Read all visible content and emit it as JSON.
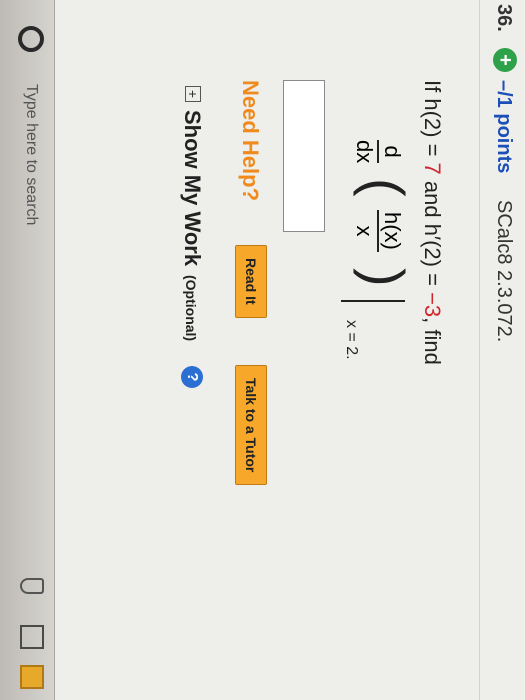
{
  "question": {
    "number": "36.",
    "points": "–/1 points",
    "code": "SCalc8 2.3.072.",
    "plus_icon": "plus-circle-icon"
  },
  "problem": {
    "p1": "If ",
    "p2": "h(2) = ",
    "h2": "7",
    "p3": " and ",
    "p4": "h′(2) = ",
    "hp2": "−3",
    "p5": ", find",
    "d": "d",
    "dx": "dx",
    "hx": "h(x)",
    "x": "x",
    "eval": "x = 2."
  },
  "answer": {
    "value": ""
  },
  "help": {
    "label": "Need Help?",
    "read_it": "Read It",
    "talk_tutor": "Talk to a Tutor"
  },
  "show_work": {
    "toggle": "+",
    "label": "Show My Work",
    "optional": "(Optional)",
    "help_glyph": "?"
  },
  "taskbar": {
    "search_placeholder": "Type here to search"
  },
  "colors": {
    "points_blue": "#1d4fb8",
    "value_red": "#d0272e",
    "help_orange": "#f08a1c",
    "button_orange": "#f7a82a"
  }
}
